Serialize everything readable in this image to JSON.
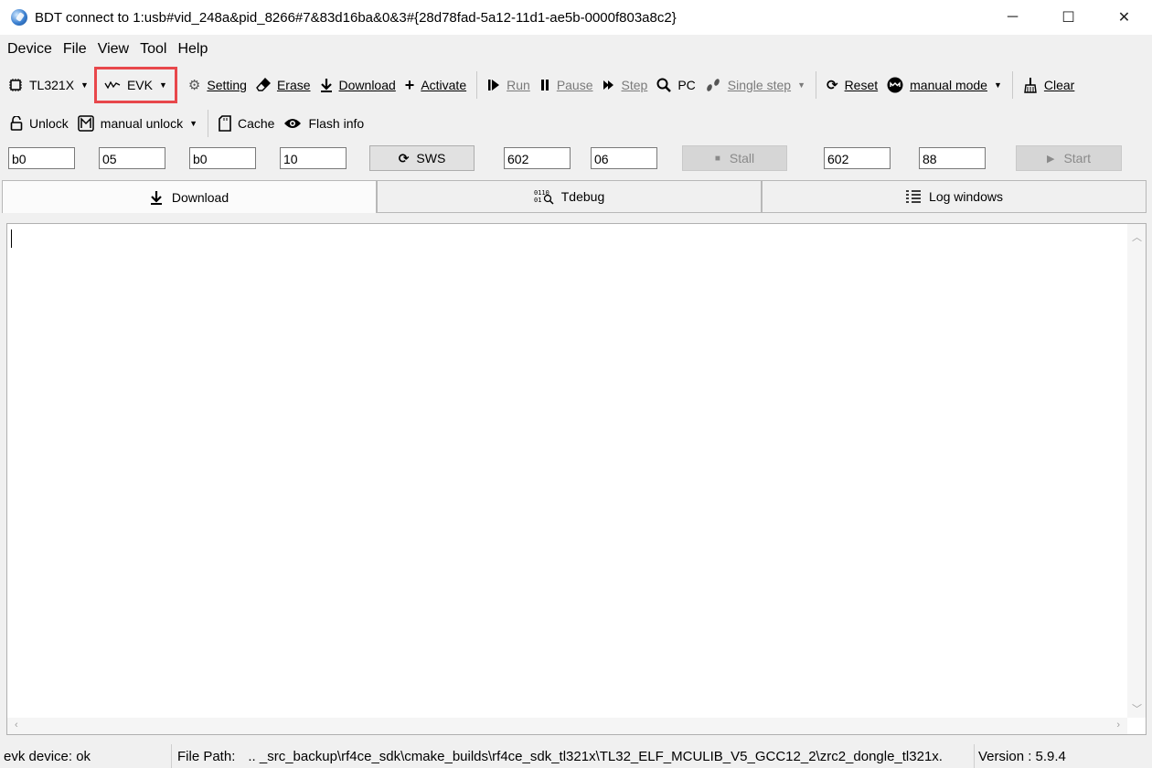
{
  "window": {
    "title": "BDT connect to 1:usb#vid_248a&pid_8266#7&83d16ba&0&3#{28d78fad-5a12-11d1-ae5b-0000f803a8c2}",
    "minimize": "─",
    "maximize": "☐",
    "close": "✕"
  },
  "menu": [
    "Device",
    "File",
    "View",
    "Tool",
    "Help"
  ],
  "toolbar1": {
    "chip": "TL321X",
    "evk": "EVK",
    "setting": "Setting",
    "erase": "Erase",
    "download": "Download",
    "activate": "Activate",
    "run": "Run",
    "pause": "Pause",
    "step": "Step",
    "pc": "PC",
    "single_step": "Single step",
    "reset": "Reset",
    "mode": "manual mode",
    "clear": "Clear"
  },
  "toolbar2": {
    "unlock": "Unlock",
    "manual_unlock": "manual unlock",
    "cache": "Cache",
    "flash_info": "Flash info"
  },
  "fields": {
    "f1": "b0",
    "f2": "05",
    "f3": "b0",
    "f4": "10",
    "sws": "SWS",
    "f5": "602",
    "f6": "06",
    "stall": "Stall",
    "f7": "602",
    "f8": "88",
    "start": "Start"
  },
  "tabs": [
    "Download",
    "Tdebug",
    "Log windows"
  ],
  "status": {
    "device": "evk device: ok",
    "file_path_label": "File Path:",
    "file_path": "..  _src_backup\\rf4ce_sdk\\cmake_builds\\rf4ce_sdk_tl321x\\TL32_ELF_MCULIB_V5_GCC12_2\\zrc2_dongle_tl321x.",
    "version": "Version : 5.9.4"
  }
}
